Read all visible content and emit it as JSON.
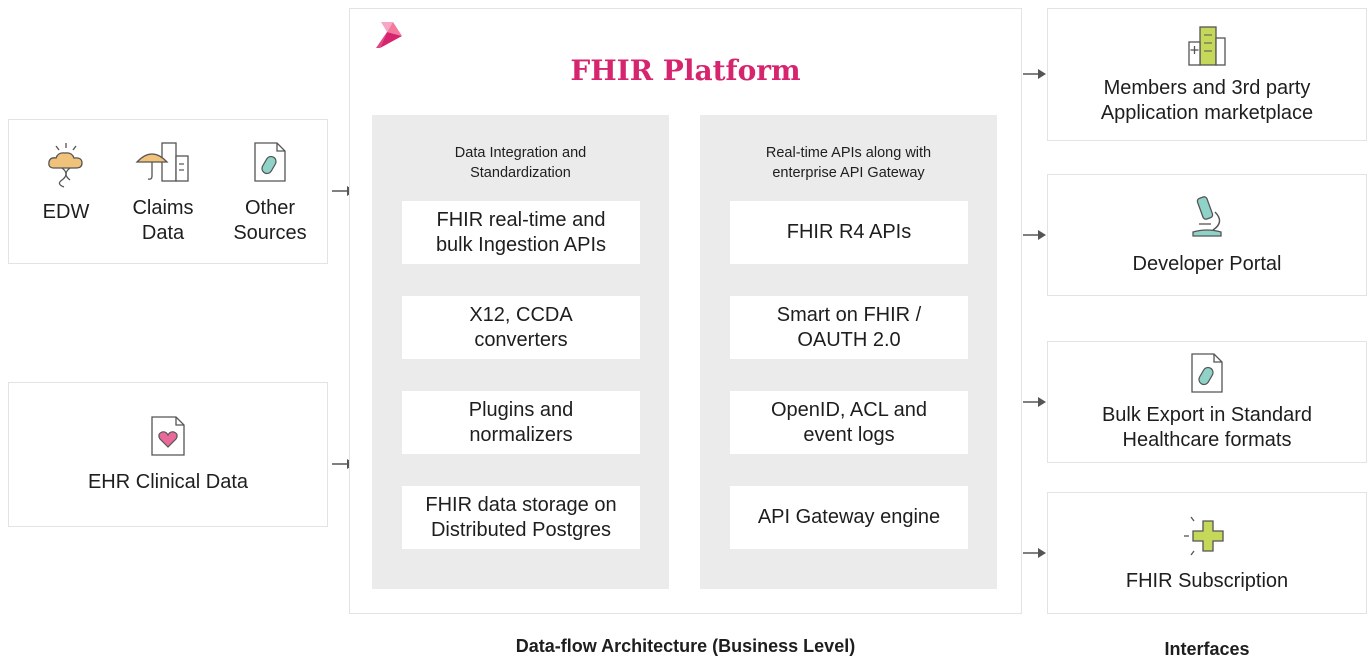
{
  "platform": {
    "title": "FHIR Platform",
    "brand_colors": [
      "#d6256e",
      "#f7a6c6"
    ]
  },
  "sources": {
    "items": [
      {
        "label": "EDW",
        "icon": "cloud-dna-icon"
      },
      {
        "label": "Claims\nData",
        "icon": "umbrella-building-icon"
      },
      {
        "label": "Other\nSources",
        "icon": "document-pill-icon"
      }
    ],
    "ehr": {
      "label": "EHR Clinical Data",
      "icon": "document-heart-icon"
    }
  },
  "integration": {
    "title": "Data Integration and\nStandardization",
    "items": [
      "FHIR real-time and\nbulk Ingestion APIs",
      "X12, CCDA\nconverters",
      "Plugins and\nnormalizers",
      "FHIR data storage on\nDistributed Postgres"
    ]
  },
  "apis": {
    "title": "Real-time APIs along with\nenterprise API Gateway",
    "items": [
      "FHIR R4 APIs",
      "Smart on FHIR /\nOAUTH 2.0",
      "OpenID, ACL and\nevent logs",
      "API Gateway engine"
    ]
  },
  "interfaces": {
    "items": [
      {
        "label": "Members and 3rd party\nApplication marketplace",
        "icon": "buildings-icon"
      },
      {
        "label": "Developer Portal",
        "icon": "microscope-icon"
      },
      {
        "label": "Bulk Export in Standard\nHealthcare formats",
        "icon": "document-pill-icon"
      },
      {
        "label": "FHIR Subscription",
        "icon": "plus-sparkle-icon"
      }
    ]
  },
  "captions": {
    "architecture": "Data-flow Architecture (Business Level)",
    "interfaces": "Interfaces"
  },
  "colors": {
    "accent": "#d6256e",
    "panel": "#ebebeb",
    "icon_green": "#c6d85a",
    "icon_teal": "#8fd3c8",
    "icon_pink": "#e86a9a",
    "icon_orange": "#f1c27a"
  }
}
